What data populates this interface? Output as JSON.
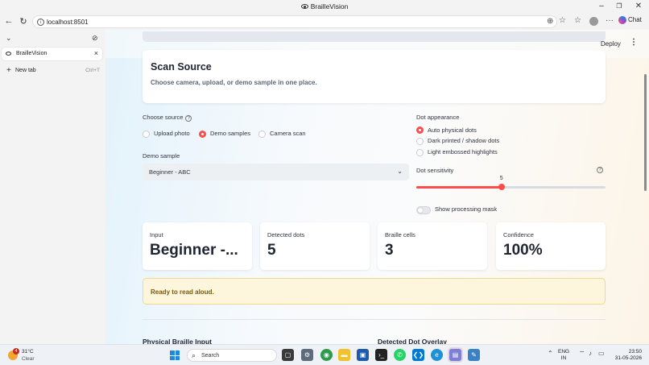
{
  "window": {
    "title": "BrailleVision"
  },
  "browser": {
    "url": "localhost:8501",
    "chat_label": "Chat",
    "tabs": [
      {
        "label": "BrailleVision"
      }
    ],
    "new_tab": {
      "label": "New tab",
      "shortcut": "Ctrl+T"
    }
  },
  "app": {
    "deploy_label": "Deploy",
    "scan_card": {
      "title": "Scan Source",
      "subtitle": "Choose camera, upload, or demo sample in one place."
    },
    "choose_source": {
      "label": "Choose source",
      "options": [
        "Upload photo",
        "Demo samples",
        "Camera scan"
      ],
      "selected": "Demo samples"
    },
    "demo_sample": {
      "label": "Demo sample",
      "value": "Beginner - ABC"
    },
    "dot_appearance": {
      "label": "Dot appearance",
      "options": [
        "Auto physical dots",
        "Dark printed / shadow dots",
        "Light embossed highlights"
      ],
      "selected": "Auto physical dots"
    },
    "dot_sensitivity": {
      "label": "Dot sensitivity",
      "value": "5",
      "fraction": 0.45
    },
    "processing_mask": {
      "label": "Show processing mask",
      "checked": false
    },
    "metrics": [
      {
        "label": "Input",
        "value": "Beginner -..."
      },
      {
        "label": "Detected dots",
        "value": "5"
      },
      {
        "label": "Braille cells",
        "value": "3"
      },
      {
        "label": "Confidence",
        "value": "100%"
      }
    ],
    "alert": "Ready to read aloud.",
    "sections": [
      "Physical Braille Input",
      "Detected Dot Overlay"
    ],
    "accent_color": "#ff4b4b"
  },
  "taskbar": {
    "weather": {
      "temp": "31°C",
      "condition": "Clear",
      "badge": "4"
    },
    "search_placeholder": "Search",
    "lang": {
      "line1": "ENG",
      "line2": "IN"
    },
    "clock": {
      "time": "23:50",
      "date": "31-05-2026"
    }
  }
}
